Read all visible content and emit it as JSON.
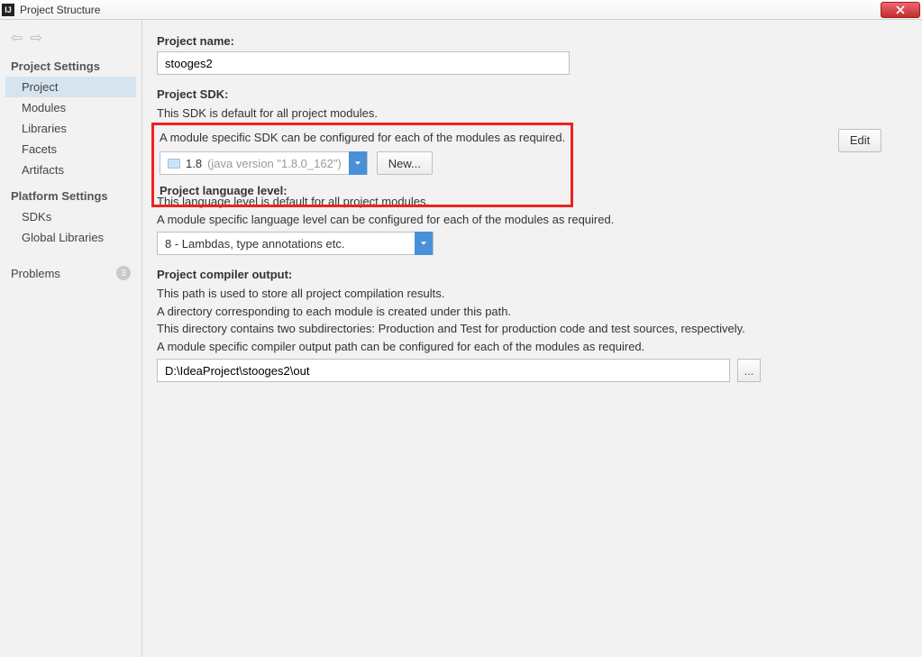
{
  "window": {
    "title": "Project Structure"
  },
  "sidebar": {
    "groups": [
      {
        "header": "Project Settings",
        "items": [
          "Project",
          "Modules",
          "Libraries",
          "Facets",
          "Artifacts"
        ]
      },
      {
        "header": "Platform Settings",
        "items": [
          "SDKs",
          "Global Libraries"
        ]
      }
    ],
    "problems": {
      "label": "Problems",
      "count": "3"
    }
  },
  "project": {
    "name_label": "Project name:",
    "name_value": "stooges2",
    "sdk_label": "Project SDK:",
    "sdk_desc1": "This SDK is default for all project modules.",
    "sdk_desc2": "A module specific SDK can be configured for each of the modules as required.",
    "sdk_value": "1.8",
    "sdk_version": "(java version \"1.8.0_162\")",
    "new_btn": "New...",
    "edit_btn": "Edit",
    "lang_label": "Project language level:",
    "lang_desc1": "This language level is default for all project modules.",
    "lang_desc2": "A module specific language level can be configured for each of the modules as required.",
    "lang_value": "8 - Lambdas, type annotations etc.",
    "out_label": "Project compiler output:",
    "out_desc1": "This path is used to store all project compilation results.",
    "out_desc2": "A directory corresponding to each module is created under this path.",
    "out_desc3": "This directory contains two subdirectories: Production and Test for production code and test sources, respectively.",
    "out_desc4": "A module specific compiler output path can be configured for each of the modules as required.",
    "out_value": "D:\\IdeaProject\\stooges2\\out",
    "browse": "..."
  }
}
